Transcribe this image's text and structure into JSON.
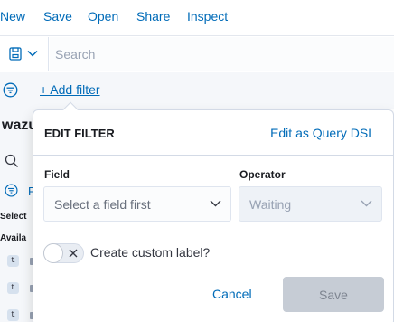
{
  "top_menu": {
    "items": [
      {
        "label": "New"
      },
      {
        "label": "Save"
      },
      {
        "label": "Open"
      },
      {
        "label": "Share"
      },
      {
        "label": "Inspect"
      }
    ]
  },
  "query_bar": {
    "saved_query_icon": "save-icon",
    "search_placeholder": "Search"
  },
  "filter_bar": {
    "icon": "filter-icon",
    "add_filter_label": "+ Add filter"
  },
  "sidebar": {
    "index_name": "wazu",
    "search_icon": "search-icon",
    "filter_link_partial": "F",
    "selected_label": "Select",
    "available_label": "Availa",
    "field_type_glyph": "t",
    "field_rows": 3
  },
  "edit_filter_popover": {
    "title": "EDIT FILTER",
    "edit_as_query_dsl": "Edit as Query DSL",
    "field": {
      "label": "Field",
      "placeholder": "Select a field first"
    },
    "operator": {
      "label": "Operator",
      "value": "Waiting",
      "disabled": true
    },
    "custom_label": {
      "label": "Create custom label?",
      "checked": false
    },
    "cancel_label": "Cancel",
    "save_label": "Save",
    "save_disabled": true
  },
  "colors": {
    "link": "#006bb8",
    "disabled_button": "#c6ccd5",
    "sidebar_bg": "#f5f7fa"
  }
}
